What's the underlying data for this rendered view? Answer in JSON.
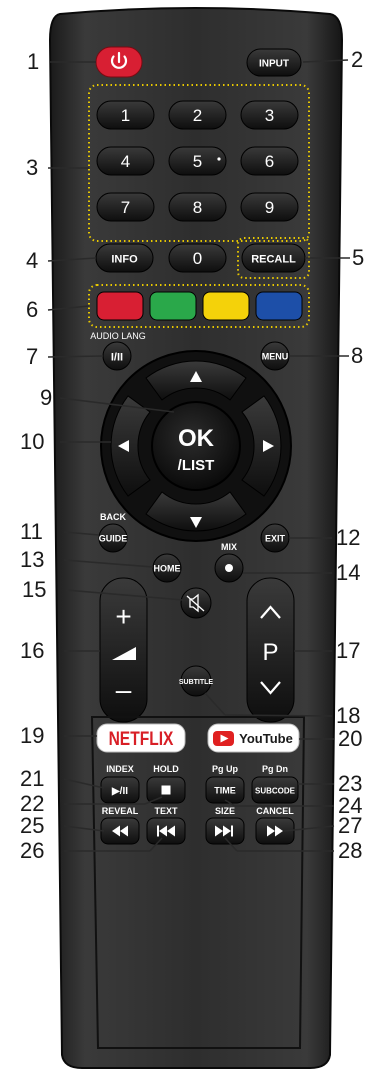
{
  "remote": {
    "power_icon": "power-icon",
    "input": "INPUT",
    "digits": [
      "1",
      "2",
      "3",
      "4",
      "5",
      "6",
      "7",
      "8",
      "9"
    ],
    "zero": "0",
    "info": "INFO",
    "recall": "RECALL",
    "color_keys": [
      {
        "name": "red",
        "color": "#d81f33"
      },
      {
        "name": "green",
        "color": "#2aa84a"
      },
      {
        "name": "yellow",
        "color": "#f4d20a"
      },
      {
        "name": "blue",
        "color": "#1d4fa8"
      }
    ],
    "audio_lang": "AUDIO LANG",
    "audio_key": "I/II",
    "menu": "MENU",
    "ok": "OK",
    "list": "/LIST",
    "back": "BACK",
    "guide": "GUIDE",
    "exit": "EXIT",
    "home": "HOME",
    "mix": "MIX",
    "mute_icon": "mute-icon",
    "vol_plus": "+",
    "vol_minus": "–",
    "ch_label": "P",
    "subtitle": "SUBTITLE",
    "netflix": "NETFLIX",
    "youtube": "YouTube",
    "index": "INDEX",
    "index_key": "▶/II",
    "hold": "HOLD",
    "pgup": "Pg Up",
    "time": "TIME",
    "pgdn": "Pg Dn",
    "subcode": "SUBCODE",
    "reveal": "REVEAL",
    "text": "TEXT",
    "size": "SIZE",
    "cancel": "CANCEL"
  },
  "callouts": {
    "c1": "1",
    "c2": "2",
    "c3": "3",
    "c4": "4",
    "c5": "5",
    "c6": "6",
    "c7": "7",
    "c8": "8",
    "c9": "9",
    "c10": "10",
    "c11": "11",
    "c12": "12",
    "c13": "13",
    "c14": "14",
    "c15": "15",
    "c16": "16",
    "c17": "17",
    "c18": "18",
    "c19": "19",
    "c20": "20",
    "c21": "21",
    "c22": "22",
    "c23": "23",
    "c24": "24",
    "c25": "25",
    "c26": "26",
    "c27": "27",
    "c28": "28"
  }
}
